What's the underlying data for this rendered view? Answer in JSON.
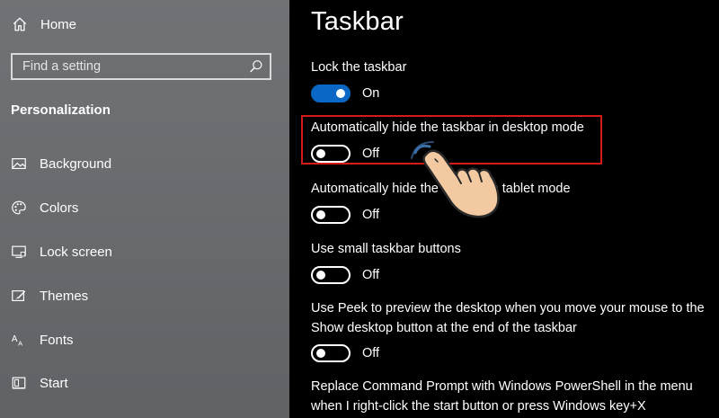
{
  "sidebar": {
    "home_label": "Home",
    "search_placeholder": "Find a setting",
    "section_title": "Personalization",
    "items": [
      {
        "label": "Background",
        "icon": "image-icon"
      },
      {
        "label": "Colors",
        "icon": "palette-icon"
      },
      {
        "label": "Lock screen",
        "icon": "monitor-icon"
      },
      {
        "label": "Themes",
        "icon": "brush-icon"
      },
      {
        "label": "Fonts",
        "icon": "fonts-icon"
      },
      {
        "label": "Start",
        "icon": "start-icon"
      }
    ]
  },
  "main": {
    "title": "Taskbar",
    "settings": [
      {
        "label": "Lock the taskbar",
        "state": "On",
        "on": true
      },
      {
        "label": "Automatically hide the taskbar in desktop mode",
        "state": "Off",
        "on": false
      },
      {
        "label": "Automatically hide the taskbar in tablet mode",
        "state": "Off",
        "on": false
      },
      {
        "label": "Use small taskbar buttons",
        "state": "Off",
        "on": false
      },
      {
        "label": "Use Peek to preview the desktop when you move your mouse to the Show desktop button at the end of the taskbar",
        "state": "Off",
        "on": false
      },
      {
        "label": "Replace Command Prompt with Windows PowerShell in the menu when I right-click the start button or press Windows key+X",
        "state": "",
        "on": false
      }
    ]
  },
  "colors": {
    "toggle_on": "#0a67c5",
    "highlight": "#d51a1a",
    "sidebar_bg": "#6c7073"
  }
}
